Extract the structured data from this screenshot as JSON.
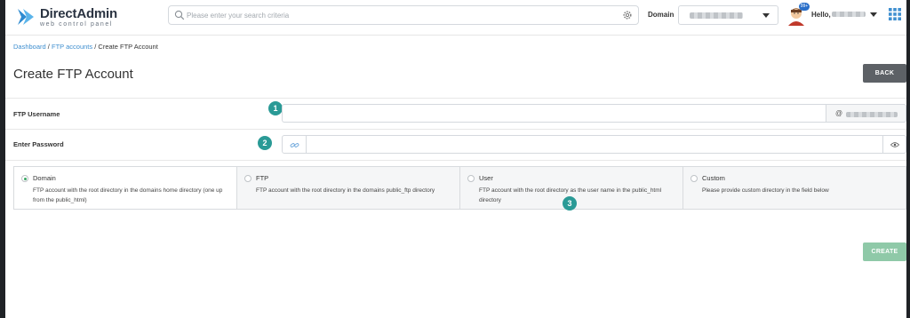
{
  "brand": {
    "title": "DirectAdmin",
    "subtitle": "web control panel"
  },
  "search": {
    "placeholder": "Please enter your search criteria"
  },
  "header": {
    "domain_label": "Domain",
    "hello_label": "Hello,",
    "notification_count": "99+"
  },
  "breadcrumb": {
    "items": [
      "Dashboard",
      "FTP accounts"
    ],
    "separator": "/",
    "current": "Create FTP Account"
  },
  "page": {
    "title": "Create FTP Account",
    "back_label": "BACK",
    "create_label": "CREATE"
  },
  "form": {
    "username_label": "FTP Username",
    "username_value": "",
    "username_suffix_prefix": "@",
    "password_label": "Enter Password",
    "password_value": ""
  },
  "steps": [
    "1",
    "2",
    "3"
  ],
  "options": [
    {
      "label": "Domain",
      "desc": "FTP account with the root directory in the domains home directory (one up from the public_html)",
      "selected": true
    },
    {
      "label": "FTP",
      "desc": "FTP account with the root directory in the domains public_ftp directory",
      "selected": false
    },
    {
      "label": "User",
      "desc": "FTP account with the root directory as the user name in the public_html directory",
      "selected": false
    },
    {
      "label": "Custom",
      "desc": "Please provide custom directory in the field below",
      "selected": false
    }
  ],
  "colors": {
    "accent_teal": "#2a9a96",
    "link_blue": "#3f8fd0",
    "back_button": "#5d6166",
    "create_button": "#8fc9a8",
    "radio_selected": "#3aa864"
  },
  "icons": [
    "directadmin-logo-icon",
    "search-icon",
    "gear-icon",
    "chevron-down-icon",
    "avatar-icon",
    "apps-grid-icon",
    "link-icon",
    "eye-icon"
  ]
}
